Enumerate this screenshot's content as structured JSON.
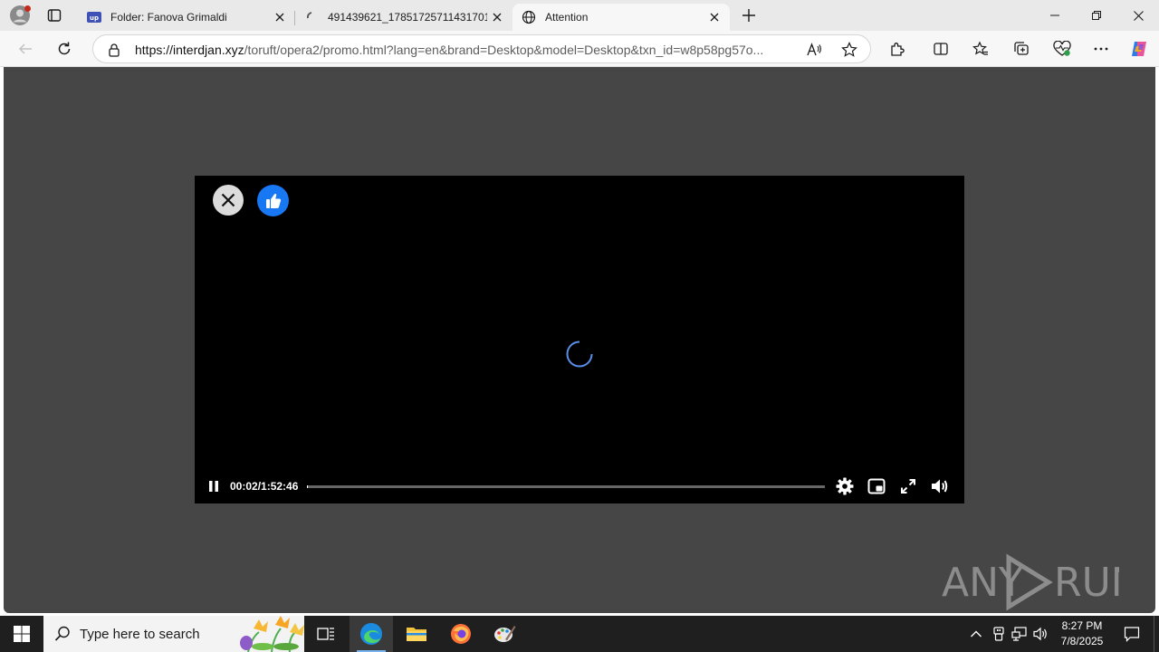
{
  "browser": {
    "tabs": [
      {
        "title": "Folder: Fanova Grimaldi",
        "favicon": "up-folder-icon",
        "active": false
      },
      {
        "title": "491439621_17851725711431701_",
        "favicon": "loading-icon",
        "active": false
      },
      {
        "title": "Attention",
        "favicon": "globe-icon",
        "active": true
      }
    ],
    "address_bar": {
      "url_host": "https://interdjan.xyz",
      "url_rest": "/toruft/opera2/promo.html?lang=en&brand=Desktop&model=Desktop&txn_id=w8p58pg57o..."
    }
  },
  "player": {
    "timecode": "00:02/1:52:46",
    "progress_fraction": 0.0003,
    "state": "buffering"
  },
  "watermark": {
    "text_left": "ANY",
    "text_right": "RUN"
  },
  "taskbar": {
    "search_placeholder": "Type here to search",
    "time": "8:27 PM",
    "date": "7/8/2025"
  },
  "colors": {
    "page_bg": "#464646",
    "like_blue": "#1877f2",
    "spinner_blue": "#5b8ee6",
    "taskbar_bg": "#1f1f1f"
  }
}
